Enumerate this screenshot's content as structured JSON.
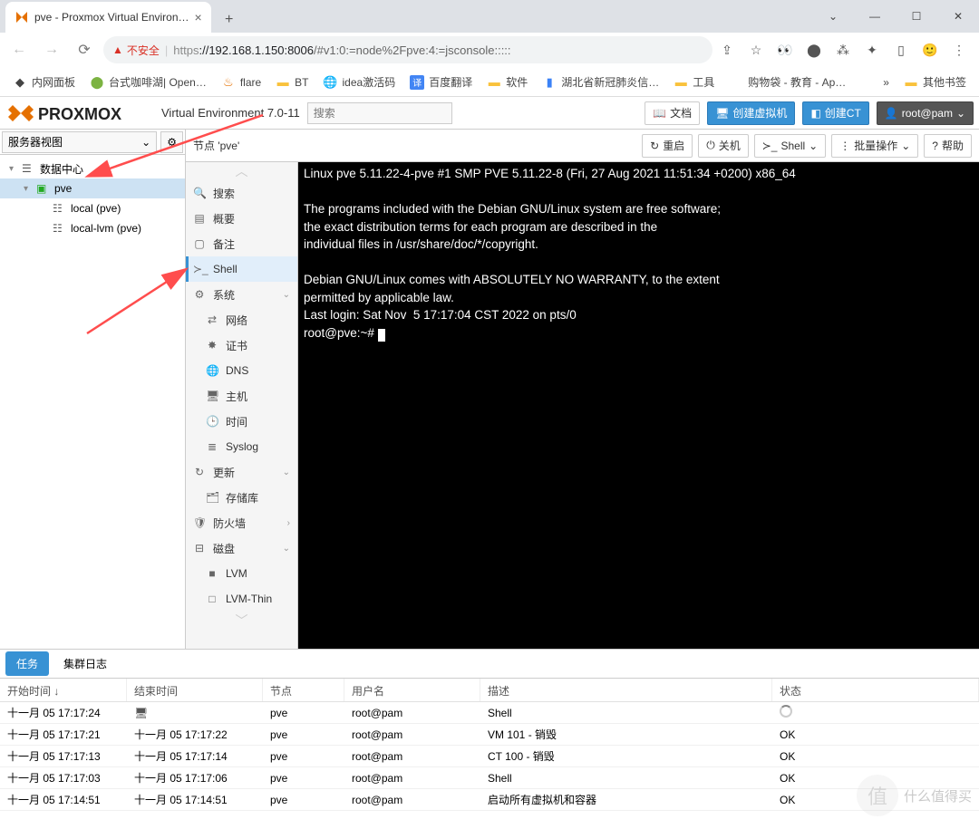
{
  "browser": {
    "tab_title": "pve - Proxmox Virtual Environ…",
    "url_warn": "不安全",
    "url_proto": "https",
    "url_host": "://192.168.1.150:8006",
    "url_path": "/#v1:0:=node%2Fpve:4:=jsconsole:::::"
  },
  "bookmarks": {
    "b0": "内网面板",
    "b1": "台式咖啡湖| Open…",
    "b2": "flare",
    "b3": "BT",
    "b4": "idea激活码",
    "b5": "百度翻译",
    "b6": "软件",
    "b7": "湖北省新冠肺炎信…",
    "b8": "工具",
    "b9": "购物袋 - 教育 - Ap…",
    "more": "»",
    "other": "其他书签"
  },
  "header": {
    "ver": "Virtual Environment 7.0-11",
    "search_ph": "搜索",
    "docs": "文档",
    "create_vm": "创建虚拟机",
    "create_ct": "创建CT",
    "user": "root@pam"
  },
  "tree": {
    "view": "服务器视图",
    "dc": "数据中心",
    "node": "pve",
    "storage0": "local (pve)",
    "storage1": "local-lvm (pve)"
  },
  "toolbar": {
    "crumb": "节点 'pve'",
    "reboot": "重启",
    "shutdown": "关机",
    "shell": "Shell",
    "bulk": "批量操作",
    "help": "帮助"
  },
  "menu": {
    "search": "搜索",
    "summary": "概要",
    "notes": "备注",
    "shell": "Shell",
    "system": "系统",
    "network": "网络",
    "cert": "证书",
    "dns": "DNS",
    "hosts": "主机",
    "time": "时间",
    "syslog": "Syslog",
    "updates": "更新",
    "repo": "存储库",
    "firewall": "防火墙",
    "disks": "磁盘",
    "lvm": "LVM",
    "lvmthin": "LVM-Thin"
  },
  "terminal": {
    "l1": "Linux pve 5.11.22-4-pve #1 SMP PVE 5.11.22-8 (Fri, 27 Aug 2021 11:51:34 +0200) x86_64",
    "l2": "",
    "l3": "The programs included with the Debian GNU/Linux system are free software;",
    "l4": "the exact distribution terms for each program are described in the",
    "l5": "individual files in /usr/share/doc/*/copyright.",
    "l6": "",
    "l7": "Debian GNU/Linux comes with ABSOLUTELY NO WARRANTY, to the extent",
    "l8": "permitted by applicable law.",
    "l9": "Last login: Sat Nov  5 17:17:04 CST 2022 on pts/0",
    "prompt": "root@pve:~# "
  },
  "bottom": {
    "tasks": "任务",
    "cluster": "集群日志",
    "h0": "开始时间 ↓",
    "h1": "结束时间",
    "h2": "节点",
    "h3": "用户名",
    "h4": "描述",
    "h5": "状态",
    "rows": [
      {
        "start": "十一月 05 17:17:24",
        "end": "",
        "node": "pve",
        "user": "root@pam",
        "desc": "Shell",
        "status": "spinner"
      },
      {
        "start": "十一月 05 17:17:21",
        "end": "十一月 05 17:17:22",
        "node": "pve",
        "user": "root@pam",
        "desc": "VM 101 - 销毁",
        "status": "OK"
      },
      {
        "start": "十一月 05 17:17:13",
        "end": "十一月 05 17:17:14",
        "node": "pve",
        "user": "root@pam",
        "desc": "CT 100 - 销毁",
        "status": "OK"
      },
      {
        "start": "十一月 05 17:17:03",
        "end": "十一月 05 17:17:06",
        "node": "pve",
        "user": "root@pam",
        "desc": "Shell",
        "status": "OK"
      },
      {
        "start": "十一月 05 17:14:51",
        "end": "十一月 05 17:14:51",
        "node": "pve",
        "user": "root@pam",
        "desc": "启动所有虚拟机和容器",
        "status": "OK"
      }
    ]
  },
  "watermark": "什么值得买"
}
